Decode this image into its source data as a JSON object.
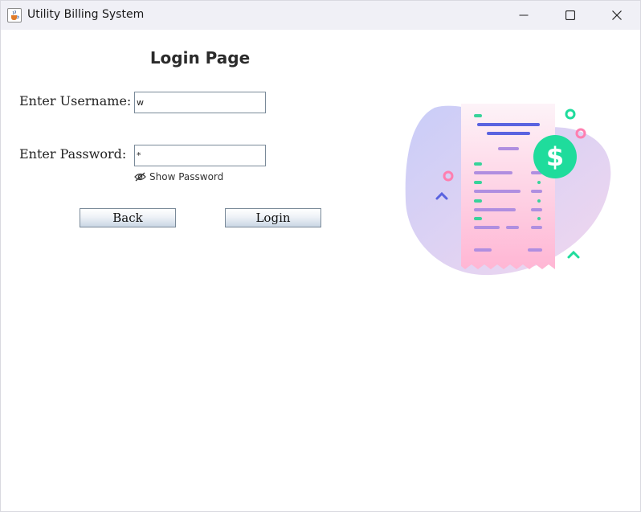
{
  "window": {
    "title": "Utility Billing System",
    "icon": "java-cup-icon",
    "controls": [
      "minimize-icon",
      "maximize-icon",
      "close-icon"
    ]
  },
  "login": {
    "heading": "Login Page",
    "username_label": "Enter Username:",
    "username_value": "w",
    "password_label": "Enter Password:",
    "password_value": "*",
    "show_password_label": "Show Password",
    "show_password_icon": "eye-slash-icon",
    "back_label": "Back",
    "login_label": "Login"
  },
  "illustration": {
    "name": "receipt-bill-illustration",
    "currency_symbol": "$",
    "colors": {
      "blob": "#c8ccf6",
      "receipt_top": "#fdf0f6",
      "receipt_bottom": "#ffb8d6",
      "dollar_circle": "#1fdc9c",
      "line_blue": "#5a63e0",
      "line_purple": "#b08ee0",
      "line_green": "#38d39a",
      "dot_pink": "#ff7fb0"
    }
  }
}
